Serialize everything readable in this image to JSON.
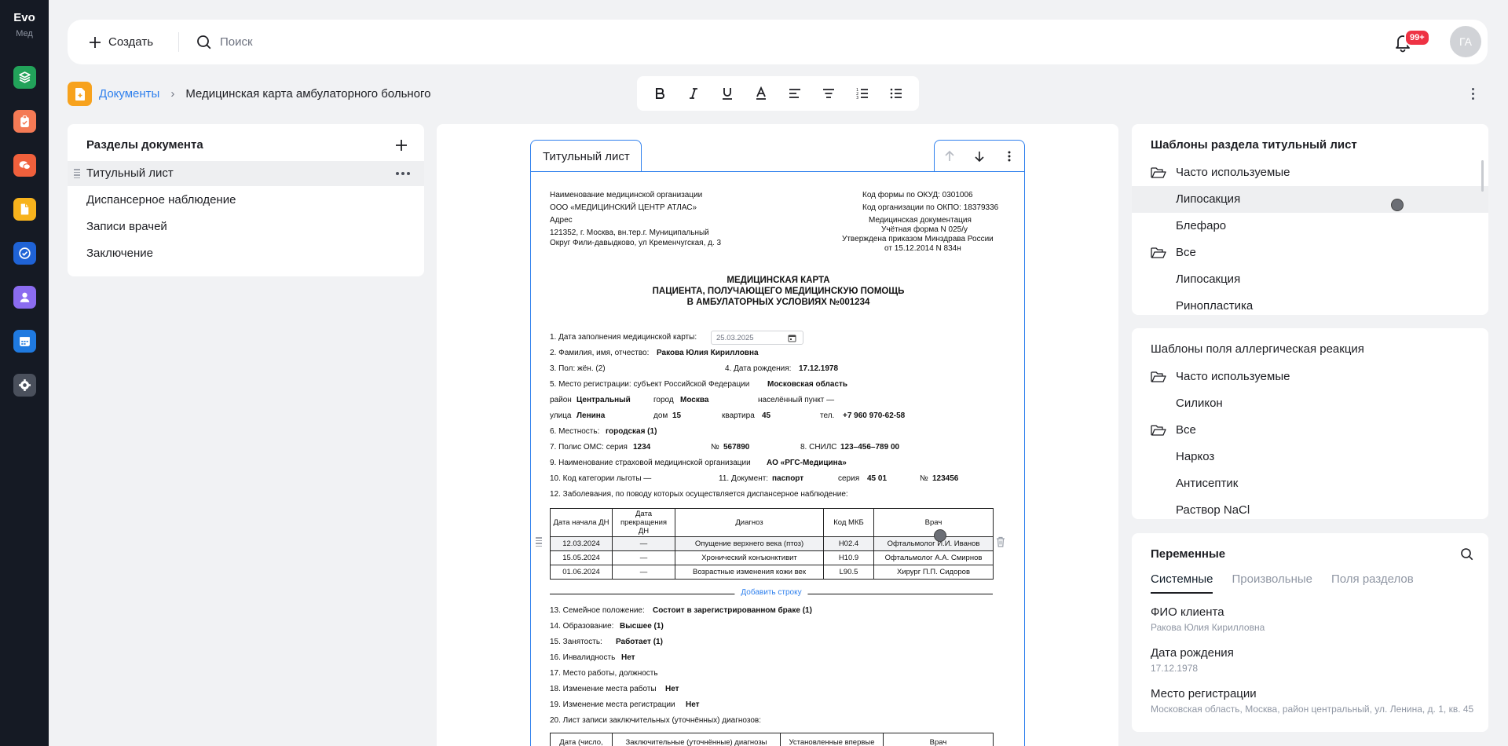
{
  "app": {
    "logo_main": "Evo",
    "logo_sub": "Мед"
  },
  "rail": {
    "items": [
      {
        "name": "layers",
        "color": "#22a35a"
      },
      {
        "name": "clipboard",
        "color": "#f47a55"
      },
      {
        "name": "chat",
        "color": "#f0603c"
      },
      {
        "name": "document",
        "color": "#f7b31d"
      },
      {
        "name": "tasks",
        "color": "#1f63d6"
      },
      {
        "name": "person",
        "color": "#8b6cf0"
      },
      {
        "name": "calendar",
        "color": "#1f7ae0"
      },
      {
        "name": "settings",
        "color": "#4a505c"
      }
    ]
  },
  "topbar": {
    "create_label": "Создать",
    "search_placeholder": "Поиск",
    "notifications_count": "99+",
    "avatar_initials": "ГА"
  },
  "breadcrumb": {
    "root": "Документы",
    "current": "Медицинская карта амбулаторного больного"
  },
  "toolbar": {
    "buttons": [
      "bold",
      "italic",
      "underline",
      "text-color",
      "align-left",
      "align-center",
      "numbered-list",
      "bulleted-list"
    ]
  },
  "sections": {
    "title": "Разделы документа",
    "items": [
      "Титульный лист",
      "Диспансерное наблюдение",
      "Записи врачей",
      "Заключение"
    ],
    "active_index": 0
  },
  "editor": {
    "tab_label": "Титульный лист"
  },
  "doc": {
    "org_label": "Наименование медицинской организации",
    "org_name": "ООО «МЕДИЦИНСКИЙ ЦЕНТР АТЛАС»",
    "address_label": "Адрес",
    "address_line1": "121352, г. Москва, вн.тер.г. Муниципальный",
    "address_line2": "Округ Фили-давыдково, ул Кременчугская, д. 3",
    "okud": "Код формы по ОКУД: 0301006",
    "okpo": "Код организации по ОКПО: 18379336",
    "med_doc": "Медицинская документация",
    "form": "Учётная форма N 025/у",
    "approved": "Утверждена приказом Минздрава России",
    "approved_date": "от 15.12.2014 N 834н",
    "title1": "МЕДИЦИНСКАЯ КАРТА",
    "title2": "ПАЦИЕНТА, ПОЛУЧАЮЩЕГО МЕДИЦИНСКУЮ ПОМОЩЬ",
    "title3": "В АМБУЛАТОРНЫХ УСЛОВИЯХ №001234",
    "f1_label": "1. Дата заполнения медицинской карты:",
    "f1_value": "25.03.2025",
    "f2_label": "2. Фамилия, имя, отчество:",
    "f2_value": "Ракова Юлия Кирилловна",
    "f3": "3. Пол: жён. (2)",
    "f4_label": "4. Дата рождения:",
    "f4_value": "17.12.1978",
    "f5_label": "5. Место регистрации: субъект Российской Федерации",
    "f5_value": "Московская область",
    "district_label": "район",
    "district_value": "Центральный",
    "city_label": "город",
    "city_value": "Москва",
    "locality_label": "населённый пункт —",
    "street_label": "улица",
    "street_value": "Ленина",
    "house_label": "дом",
    "house_value": "15",
    "apt_label": "квартира",
    "apt_value": "45",
    "phone_label": "тел.",
    "phone_value": "+7 960 970-62-58",
    "f6_label": "6. Местность:",
    "f6_value": "городская (1)",
    "f7_label": "7. Полис ОМС: серия",
    "f7_series": "1234",
    "f7_num_label": "№",
    "f7_num": "567890",
    "f8_label": "8. СНИЛС",
    "f8_value": "123–456–789 00",
    "f9_label": "9. Наименование страховой медицинской организации",
    "f9_value": "АО «РГС-Медицина»",
    "f10": "10. Код категории льготы —",
    "f11_label": "11. Документ:",
    "f11_value": "паспорт",
    "f11_series_label": "серия",
    "f11_series": "45 01",
    "f11_num_label": "№",
    "f11_num": "123456",
    "f12": "12. Заболевания, по поводу которых осуществляется диспансерное наблюдение:",
    "table_headers": [
      "Дата начала ДН",
      "Дата прекращения ДН",
      "Диагноз",
      "Код МКБ",
      "Врач"
    ],
    "table_rows": [
      [
        "12.03.2024",
        "—",
        "Опущение верхнего века (птоз)",
        "H02.4",
        "Офтальмолог И.И. Иванов"
      ],
      [
        "15.05.2024",
        "—",
        "Хронический конъюнктивит",
        "H10.9",
        "Офтальмолог А.А. Смирнов"
      ],
      [
        "01.06.2024",
        "—",
        "Возрастные изменения кожи век",
        "L90.5",
        "Хирург П.П. Сидоров"
      ]
    ],
    "add_row": "Добавить строку",
    "f13_label": "13. Семейное положение:",
    "f13_value": "Состоит в зарегистрированном браке (1)",
    "f14_label": "14. Образование:",
    "f14_value": "Высшее (1)",
    "f15_label": "15. Занятость:",
    "f15_value": "Работает (1)",
    "f16_label": "16. Инвалидность",
    "f16_value": "Нет",
    "f17": "17. Место работы, должность",
    "f18_label": "18. Изменение места работы",
    "f18_value": "Нет",
    "f19_label": "19. Изменение места регистрации",
    "f19_value": "Нет",
    "f20": "20. Лист записи заключительных (уточнённых) диагнозов:",
    "final_headers": [
      "Дата (число,",
      "Заключительные (уточнённые) диагнозы",
      "Установленные впервые",
      "Врач"
    ]
  },
  "templates1": {
    "title": "Шаблоны раздела титульный лист",
    "items": [
      {
        "type": "folder",
        "label": "Часто используемые"
      },
      {
        "type": "leaf",
        "label": "Липосакция",
        "selected": true
      },
      {
        "type": "leaf",
        "label": "Блефаро"
      },
      {
        "type": "folder",
        "label": "Все"
      },
      {
        "type": "leaf",
        "label": "Липосакция"
      },
      {
        "type": "leaf",
        "label": "Ринопластика"
      }
    ]
  },
  "templates2": {
    "title": "Шаблоны поля аллергическая реакция",
    "items": [
      {
        "type": "folder",
        "label": "Часто используемые"
      },
      {
        "type": "leaf",
        "label": "Силикон"
      },
      {
        "type": "folder",
        "label": "Все"
      },
      {
        "type": "leaf",
        "label": "Наркоз"
      },
      {
        "type": "leaf",
        "label": "Антисептик"
      },
      {
        "type": "leaf",
        "label": "Раствор NaCl"
      }
    ]
  },
  "variables": {
    "title": "Переменные",
    "tabs": [
      "Системные",
      "Произвольные",
      "Поля разделов"
    ],
    "active_tab": 0,
    "items": [
      {
        "key": "ФИО клиента",
        "value": "Ракова Юлия Кирилловна"
      },
      {
        "key": "Дата рождения",
        "value": "17.12.1978"
      },
      {
        "key": "Место регистрации",
        "value": "Московская область, Москва, район центральный, ул. Ленина, д. 1, кв. 45"
      }
    ]
  }
}
